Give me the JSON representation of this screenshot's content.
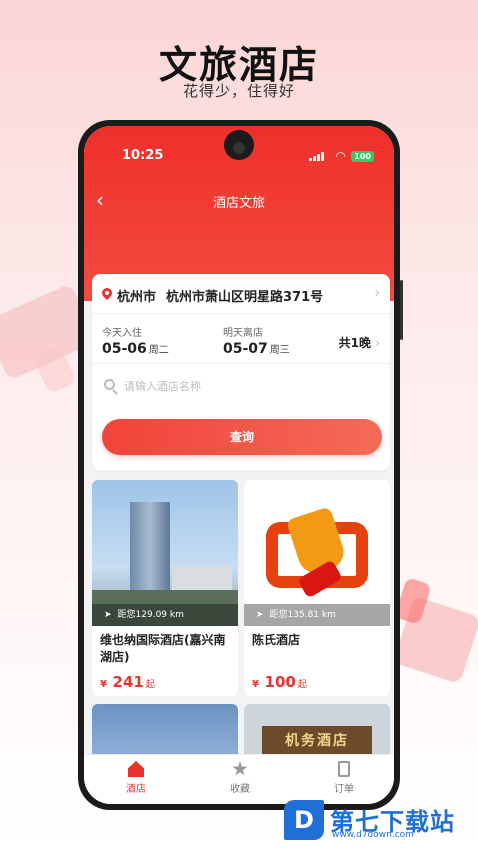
{
  "promo": {
    "title": "文旅酒店",
    "subtitle": "花得少，住得好"
  },
  "status_bar": {
    "time": "10:25",
    "battery": "100"
  },
  "nav": {
    "back_icon": "chevron-left-icon",
    "title": "酒店文旅"
  },
  "search": {
    "city": "杭州市",
    "address": "杭州市萧山区明星路371号",
    "checkin_label": "今天入住",
    "checkin_date": "05-06",
    "checkin_week": "周二",
    "checkout_label": "明天离店",
    "checkout_date": "05-07",
    "checkout_week": "周三",
    "nights": "共1晚",
    "keyword_placeholder": "请输入酒店名称",
    "query_button": "查询"
  },
  "hotels": [
    {
      "name": "维也纳国际酒店(嘉兴南湖店)",
      "distance": "距您129.09 km",
      "currency": "¥",
      "price": "241",
      "price_suffix": "起"
    },
    {
      "name": "陈氏酒店",
      "distance": "距您135.81 km",
      "currency": "¥",
      "price": "100",
      "price_suffix": "起"
    }
  ],
  "peek_sign": "机务酒店",
  "tabs": [
    {
      "label": "酒店",
      "icon": "home-icon",
      "active": true
    },
    {
      "label": "收藏",
      "icon": "star-icon",
      "active": false
    },
    {
      "label": "订单",
      "icon": "order-icon",
      "active": false
    }
  ],
  "watermark": {
    "logo": "D",
    "text": "第七下载站",
    "url": "www.d7down.com"
  },
  "colors": {
    "accent": "#e8332e",
    "header": "#ef2f29",
    "watermark": "#1f6fd6"
  }
}
